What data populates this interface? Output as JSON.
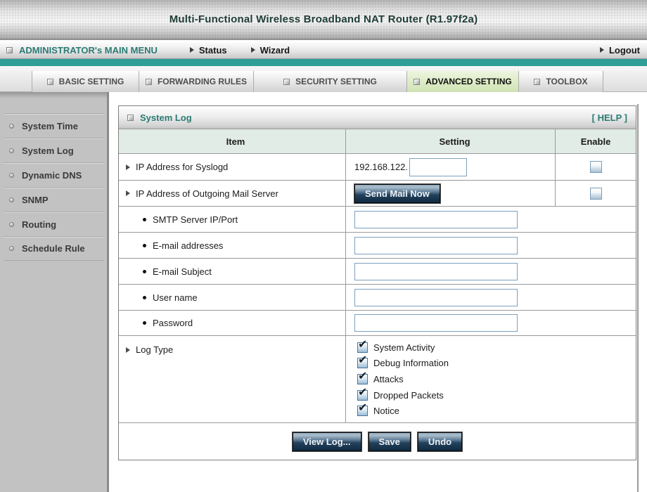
{
  "colors": {
    "teal_bar": "#2E9E97",
    "teal_text": "#2B7B74",
    "active_tab_bg": "#DCEBC4",
    "header_row_bg": "#E2ECE6",
    "button_face": "#24425D"
  },
  "title_bar": {
    "title": "Multi-Functional Wireless Broadband NAT Router (R1.97f2a)"
  },
  "menu_bar": {
    "main_menu_label": "ADMINISTRATOR's MAIN MENU",
    "status_label": "Status",
    "wizard_label": "Wizard",
    "logout_label": "Logout"
  },
  "tabs": [
    {
      "label": "BASIC SETTING",
      "active": false
    },
    {
      "label": "FORWARDING RULES",
      "active": false
    },
    {
      "label": "SECURITY SETTING",
      "active": false
    },
    {
      "label": "ADVANCED SETTING",
      "active": true
    },
    {
      "label": "TOOLBOX",
      "active": false
    }
  ],
  "sidebar": {
    "items": [
      {
        "label": "System Time"
      },
      {
        "label": "System Log"
      },
      {
        "label": "Dynamic DNS"
      },
      {
        "label": "SNMP"
      },
      {
        "label": "Routing"
      },
      {
        "label": "Schedule Rule"
      }
    ]
  },
  "panel": {
    "title": "System Log",
    "help_label": "[ HELP ]",
    "columns": {
      "item": "Item",
      "setting": "Setting",
      "enable": "Enable"
    },
    "syslog_row": {
      "label": "IP Address for Syslogd",
      "ip_prefix": "192.168.122.",
      "input_value": "",
      "enabled": false
    },
    "mail_row": {
      "label": "IP Address of Outgoing Mail Server",
      "button_label": "Send Mail Now",
      "enabled": false
    },
    "text_rows": [
      {
        "label": "SMTP Server IP/Port",
        "value": ""
      },
      {
        "label": "E-mail addresses",
        "value": ""
      },
      {
        "label": "E-mail Subject",
        "value": ""
      },
      {
        "label": "User name",
        "value": ""
      },
      {
        "label": "Password",
        "value": ""
      }
    ],
    "log_type_row": {
      "label": "Log Type",
      "options": [
        {
          "label": "System Activity",
          "checked": true
        },
        {
          "label": "Debug Information",
          "checked": true
        },
        {
          "label": "Attacks",
          "checked": true
        },
        {
          "label": "Dropped Packets",
          "checked": true
        },
        {
          "label": "Notice",
          "checked": true
        }
      ]
    },
    "buttons": [
      {
        "label": "View Log..."
      },
      {
        "label": "Save"
      },
      {
        "label": "Undo"
      }
    ]
  }
}
